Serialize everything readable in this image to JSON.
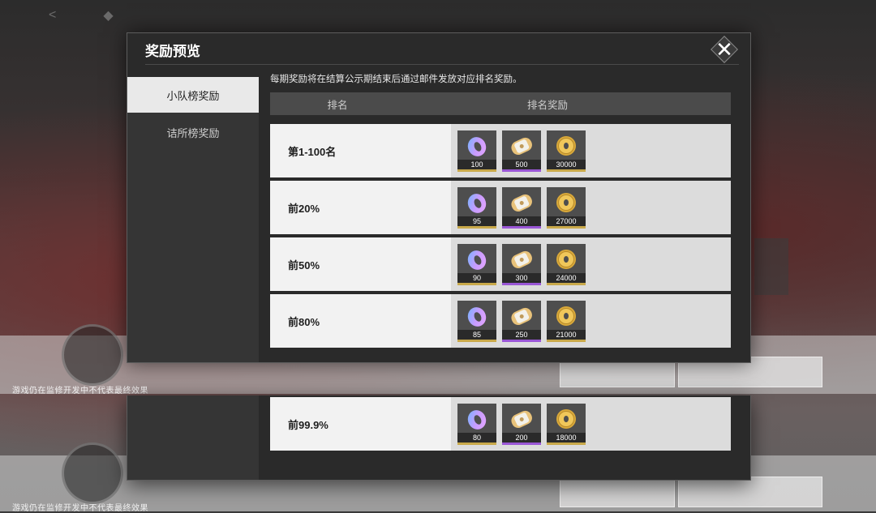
{
  "watermark": "游戏仍在监修开发中不代表最终效果",
  "dialog": {
    "title": "奖励预览",
    "close_glyph": "✕",
    "notice": "每期奖励将在结算公示期结束后通过邮件发放对应排名奖励。",
    "tabs": [
      {
        "label": "小队榜奖励",
        "active": true
      },
      {
        "label": "诘所榜奖励",
        "active": false
      }
    ],
    "table": {
      "headers": [
        "排名",
        "排名奖励"
      ],
      "reward_icons": [
        "ring-token-icon",
        "ticket-coin-icon",
        "gold-coin-icon"
      ],
      "rows": [
        {
          "rank": "第1-100名",
          "rewards": [
            "100",
            "500",
            "30000"
          ]
        },
        {
          "rank": "前20%",
          "rewards": [
            "95",
            "400",
            "27000"
          ]
        },
        {
          "rank": "前50%",
          "rewards": [
            "90",
            "300",
            "24000"
          ]
        },
        {
          "rank": "前80%",
          "rewards": [
            "85",
            "250",
            "21000"
          ]
        },
        {
          "rank": "前99.9%",
          "rewards": [
            "80",
            "200",
            "18000"
          ]
        }
      ]
    }
  },
  "colors": {
    "panel": "#2a2a2a",
    "row_bg": "#f2f2f2",
    "gold_rarity": "#c9a94a",
    "purple_rarity": "#9a57d6"
  }
}
